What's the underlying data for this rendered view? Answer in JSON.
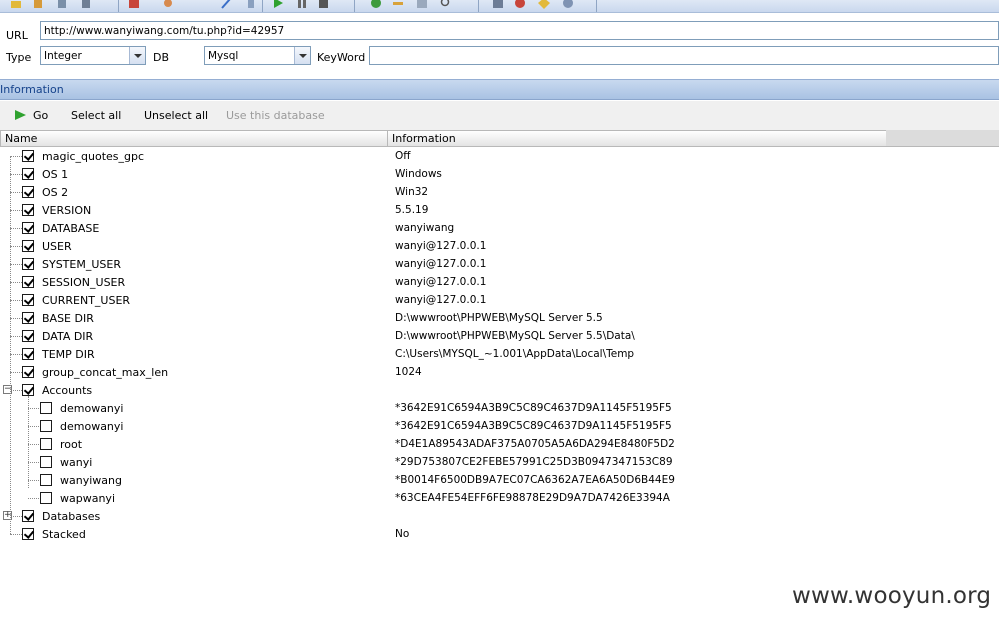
{
  "toolbar": {
    "icons": [
      "open-icon",
      "paste-icon",
      "settings-icon",
      "chart-icon",
      "palette-icon",
      "pen-icon",
      "bug-icon",
      "play-icon",
      "pause-icon",
      "stop-icon",
      "info-icon",
      "key-icon",
      "refresh-icon",
      "search-icon",
      "save-icon",
      "burn-icon",
      "star-icon",
      "help-icon"
    ]
  },
  "form": {
    "url_label": "URL",
    "url_value": "http://www.wanyiwang.com/tu.php?id=42957",
    "type_label": "Type",
    "type_value": "Integer",
    "db_label": "DB",
    "db_value": "Mysql",
    "keyword_label": "KeyWord",
    "keyword_value": ""
  },
  "panel": {
    "title": "Information",
    "actions": {
      "go": "Go",
      "select_all": "Select all",
      "unselect_all": "Unselect all",
      "use_db": "Use this database"
    },
    "columns": {
      "name": "Name",
      "info": "Information"
    }
  },
  "rows": [
    {
      "name": "magic_quotes_gpc",
      "value": "Off"
    },
    {
      "name": "OS 1",
      "value": "Windows"
    },
    {
      "name": "OS 2",
      "value": "Win32"
    },
    {
      "name": "VERSION",
      "value": "5.5.19"
    },
    {
      "name": "DATABASE",
      "value": "wanyiwang"
    },
    {
      "name": "USER",
      "value": "wanyi@127.0.0.1"
    },
    {
      "name": "SYSTEM_USER",
      "value": "wanyi@127.0.0.1"
    },
    {
      "name": "SESSION_USER",
      "value": "wanyi@127.0.0.1"
    },
    {
      "name": "CURRENT_USER",
      "value": "wanyi@127.0.0.1"
    },
    {
      "name": "BASE DIR",
      "value": "D:\\wwwroot\\PHPWEB\\MySQL Server 5.5"
    },
    {
      "name": "DATA DIR",
      "value": "D:\\wwwroot\\PHPWEB\\MySQL Server 5.5\\Data\\"
    },
    {
      "name": "TEMP DIR",
      "value": "C:\\Users\\MYSQL_~1.001\\AppData\\Local\\Temp"
    },
    {
      "name": "group_concat_max_len",
      "value": "1024"
    },
    {
      "name": "Accounts",
      "value": ""
    },
    {
      "name": "demowanyi",
      "value": "*3642E91C6594A3B9C5C89C4637D9A1145F5195F5"
    },
    {
      "name": "demowanyi",
      "value": "*3642E91C6594A3B9C5C89C4637D9A1145F5195F5"
    },
    {
      "name": "root",
      "value": "*D4E1A89543ADAF375A0705A5A6DA294E8480F5D2"
    },
    {
      "name": "wanyi",
      "value": "*29D753807CE2FEBE57991C25D3B0947347153C89"
    },
    {
      "name": "wanyiwang",
      "value": "*B0014F6500DB9A7EC07CA6362A7EA6A50D6B44E9"
    },
    {
      "name": "wapwanyi",
      "value": "*63CEA4FE54EFF6FE98878E29D9A7DA7426E3394A"
    },
    {
      "name": "Databases",
      "value": ""
    },
    {
      "name": "Stacked",
      "value": "No"
    }
  ],
  "watermark": "www.wooyun.org"
}
